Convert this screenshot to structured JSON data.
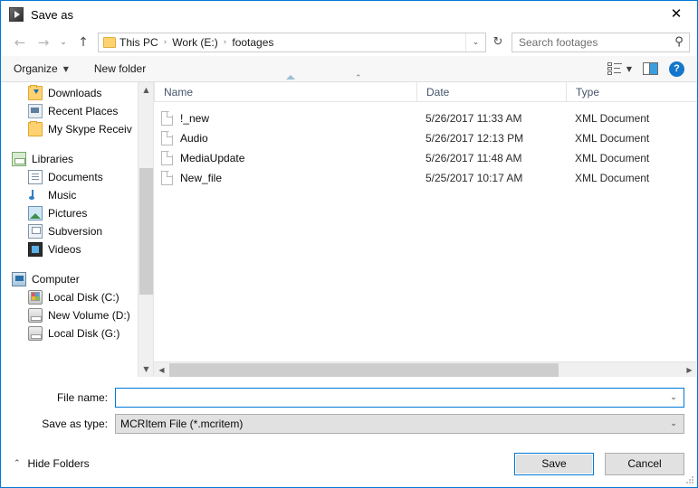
{
  "window": {
    "title": "Save as",
    "icon": "app-icon",
    "close_label": "✕",
    "accent_color": "#0078d7"
  },
  "nav": {
    "back_icon": "←",
    "forward_icon": "→",
    "history_icon": "⌄",
    "up_icon": "↑",
    "breadcrumbs": [
      "This PC",
      "Work (E:)",
      "footages"
    ],
    "separator": "›",
    "dropdown_icon": "⌄",
    "refresh_icon": "↻"
  },
  "search": {
    "placeholder": "Search footages",
    "value": "",
    "icon": "search-icon"
  },
  "toolbar": {
    "organize_label": "Organize",
    "organize_caret": "▼",
    "new_folder_label": "New folder",
    "view_caret": "▼",
    "view_icon": "view-list-icon",
    "preview_icon": "preview-pane-icon",
    "help_label": "?"
  },
  "sidebar": {
    "scroll_up_icon": "▲",
    "scroll_down_icon": "▼",
    "items": [
      {
        "label": "Downloads",
        "icon": "folder-download-icon",
        "level": "child"
      },
      {
        "label": "Recent Places",
        "icon": "recent-places-icon",
        "level": "child"
      },
      {
        "label": "My Skype Receiv",
        "icon": "folder-icon",
        "level": "child"
      },
      {
        "label": "Libraries",
        "icon": "libraries-icon",
        "level": "root"
      },
      {
        "label": "Documents",
        "icon": "documents-icon",
        "level": "child"
      },
      {
        "label": "Music",
        "icon": "music-icon",
        "level": "child"
      },
      {
        "label": "Pictures",
        "icon": "pictures-icon",
        "level": "child"
      },
      {
        "label": "Subversion",
        "icon": "subversion-icon",
        "level": "child"
      },
      {
        "label": "Videos",
        "icon": "videos-icon",
        "level": "child"
      },
      {
        "label": "Computer",
        "icon": "computer-icon",
        "level": "root"
      },
      {
        "label": "Local Disk (C:)",
        "icon": "disk-windows-icon",
        "level": "child"
      },
      {
        "label": "New Volume (D:)",
        "icon": "disk-icon",
        "level": "child"
      },
      {
        "label": "Local Disk (G:)",
        "icon": "disk-icon",
        "level": "child"
      }
    ]
  },
  "filelist": {
    "columns": [
      "Name",
      "Date",
      "Type"
    ],
    "rows": [
      {
        "name": "!_new",
        "date": "5/26/2017 11:33 AM",
        "type": "XML Document",
        "icon": "file-icon"
      },
      {
        "name": "Audio",
        "date": "5/26/2017 12:13 PM",
        "type": "XML Document",
        "icon": "file-icon"
      },
      {
        "name": "MediaUpdate",
        "date": "5/26/2017 11:48 AM",
        "type": "XML Document",
        "icon": "file-icon"
      },
      {
        "name": "New_file",
        "date": "5/25/2017 10:17 AM",
        "type": "XML Document",
        "icon": "file-icon"
      }
    ],
    "hscroll_left_icon": "◀",
    "hscroll_right_icon": "▶"
  },
  "form": {
    "filename_label": "File name:",
    "filename_value": "",
    "filename_placeholder": "",
    "savetype_label": "Save as type:",
    "savetype_value": "MCRItem File (*.mcritem)",
    "chevron_icon": "⌄"
  },
  "footer": {
    "hide_folders_label": "Hide Folders",
    "hide_folders_chevron": "⌃",
    "save_label": "Save",
    "cancel_label": "Cancel"
  }
}
